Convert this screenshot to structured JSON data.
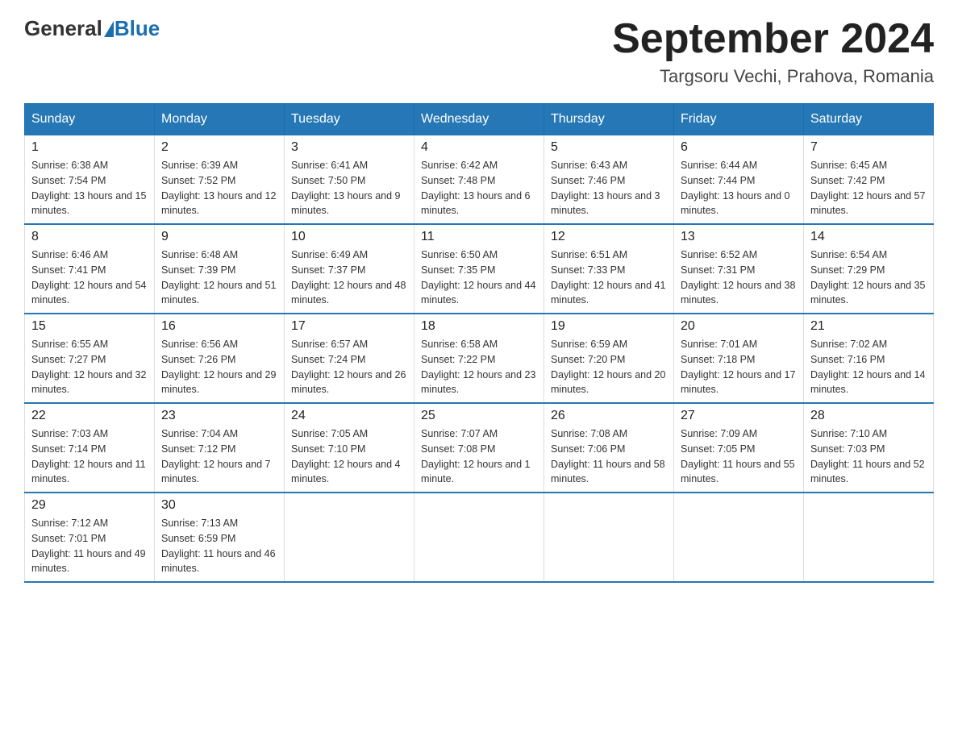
{
  "header": {
    "logo": {
      "general": "General",
      "blue": "Blue"
    },
    "title": "September 2024",
    "location": "Targsoru Vechi, Prahova, Romania"
  },
  "days_of_week": [
    "Sunday",
    "Monday",
    "Tuesday",
    "Wednesday",
    "Thursday",
    "Friday",
    "Saturday"
  ],
  "weeks": [
    [
      {
        "day": "1",
        "sunrise": "6:38 AM",
        "sunset": "7:54 PM",
        "daylight": "13 hours and 15 minutes."
      },
      {
        "day": "2",
        "sunrise": "6:39 AM",
        "sunset": "7:52 PM",
        "daylight": "13 hours and 12 minutes."
      },
      {
        "day": "3",
        "sunrise": "6:41 AM",
        "sunset": "7:50 PM",
        "daylight": "13 hours and 9 minutes."
      },
      {
        "day": "4",
        "sunrise": "6:42 AM",
        "sunset": "7:48 PM",
        "daylight": "13 hours and 6 minutes."
      },
      {
        "day": "5",
        "sunrise": "6:43 AM",
        "sunset": "7:46 PM",
        "daylight": "13 hours and 3 minutes."
      },
      {
        "day": "6",
        "sunrise": "6:44 AM",
        "sunset": "7:44 PM",
        "daylight": "13 hours and 0 minutes."
      },
      {
        "day": "7",
        "sunrise": "6:45 AM",
        "sunset": "7:42 PM",
        "daylight": "12 hours and 57 minutes."
      }
    ],
    [
      {
        "day": "8",
        "sunrise": "6:46 AM",
        "sunset": "7:41 PM",
        "daylight": "12 hours and 54 minutes."
      },
      {
        "day": "9",
        "sunrise": "6:48 AM",
        "sunset": "7:39 PM",
        "daylight": "12 hours and 51 minutes."
      },
      {
        "day": "10",
        "sunrise": "6:49 AM",
        "sunset": "7:37 PM",
        "daylight": "12 hours and 48 minutes."
      },
      {
        "day": "11",
        "sunrise": "6:50 AM",
        "sunset": "7:35 PM",
        "daylight": "12 hours and 44 minutes."
      },
      {
        "day": "12",
        "sunrise": "6:51 AM",
        "sunset": "7:33 PM",
        "daylight": "12 hours and 41 minutes."
      },
      {
        "day": "13",
        "sunrise": "6:52 AM",
        "sunset": "7:31 PM",
        "daylight": "12 hours and 38 minutes."
      },
      {
        "day": "14",
        "sunrise": "6:54 AM",
        "sunset": "7:29 PM",
        "daylight": "12 hours and 35 minutes."
      }
    ],
    [
      {
        "day": "15",
        "sunrise": "6:55 AM",
        "sunset": "7:27 PM",
        "daylight": "12 hours and 32 minutes."
      },
      {
        "day": "16",
        "sunrise": "6:56 AM",
        "sunset": "7:26 PM",
        "daylight": "12 hours and 29 minutes."
      },
      {
        "day": "17",
        "sunrise": "6:57 AM",
        "sunset": "7:24 PM",
        "daylight": "12 hours and 26 minutes."
      },
      {
        "day": "18",
        "sunrise": "6:58 AM",
        "sunset": "7:22 PM",
        "daylight": "12 hours and 23 minutes."
      },
      {
        "day": "19",
        "sunrise": "6:59 AM",
        "sunset": "7:20 PM",
        "daylight": "12 hours and 20 minutes."
      },
      {
        "day": "20",
        "sunrise": "7:01 AM",
        "sunset": "7:18 PM",
        "daylight": "12 hours and 17 minutes."
      },
      {
        "day": "21",
        "sunrise": "7:02 AM",
        "sunset": "7:16 PM",
        "daylight": "12 hours and 14 minutes."
      }
    ],
    [
      {
        "day": "22",
        "sunrise": "7:03 AM",
        "sunset": "7:14 PM",
        "daylight": "12 hours and 11 minutes."
      },
      {
        "day": "23",
        "sunrise": "7:04 AM",
        "sunset": "7:12 PM",
        "daylight": "12 hours and 7 minutes."
      },
      {
        "day": "24",
        "sunrise": "7:05 AM",
        "sunset": "7:10 PM",
        "daylight": "12 hours and 4 minutes."
      },
      {
        "day": "25",
        "sunrise": "7:07 AM",
        "sunset": "7:08 PM",
        "daylight": "12 hours and 1 minute."
      },
      {
        "day": "26",
        "sunrise": "7:08 AM",
        "sunset": "7:06 PM",
        "daylight": "11 hours and 58 minutes."
      },
      {
        "day": "27",
        "sunrise": "7:09 AM",
        "sunset": "7:05 PM",
        "daylight": "11 hours and 55 minutes."
      },
      {
        "day": "28",
        "sunrise": "7:10 AM",
        "sunset": "7:03 PM",
        "daylight": "11 hours and 52 minutes."
      }
    ],
    [
      {
        "day": "29",
        "sunrise": "7:12 AM",
        "sunset": "7:01 PM",
        "daylight": "11 hours and 49 minutes."
      },
      {
        "day": "30",
        "sunrise": "7:13 AM",
        "sunset": "6:59 PM",
        "daylight": "11 hours and 46 minutes."
      },
      null,
      null,
      null,
      null,
      null
    ]
  ]
}
